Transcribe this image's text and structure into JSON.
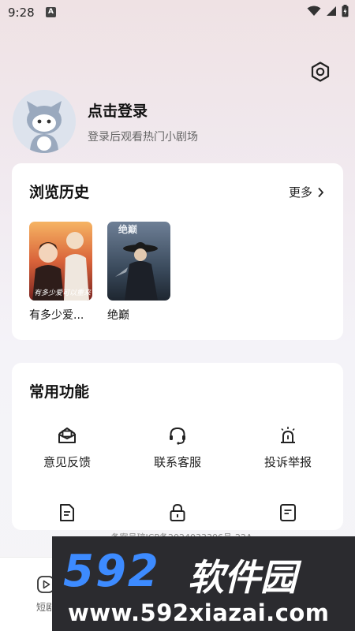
{
  "status_bar": {
    "time": "9:28",
    "notification_badge": "A"
  },
  "header": {
    "settings_icon": "gear-hexagon-icon"
  },
  "profile": {
    "title": "点击登录",
    "subtitle": "登录后观看热门小剧场"
  },
  "history": {
    "title": "浏览历史",
    "more_label": "更多",
    "items": [
      {
        "title": "有多少爱...",
        "poster_text": "有多少爱可以重来"
      },
      {
        "title": "绝巅",
        "poster_text": "绝巅"
      }
    ]
  },
  "functions": {
    "title": "常用功能",
    "items": [
      {
        "label": "意见反馈",
        "icon": "feedback-mail-icon"
      },
      {
        "label": "联系客服",
        "icon": "headset-icon"
      },
      {
        "label": "投诉举报",
        "icon": "alarm-icon"
      },
      {
        "label": "",
        "icon": "document-icon"
      },
      {
        "label": "",
        "icon": "lock-icon"
      },
      {
        "label": "",
        "icon": "note-icon"
      }
    ]
  },
  "footer": {
    "icp": "备案号琼ICP备2024033306号-22A"
  },
  "bottom_nav": {
    "items": [
      {
        "label": "短剧",
        "icon": "play-icon"
      }
    ]
  },
  "watermark": {
    "number": "592",
    "name": "软件园",
    "url": "www.592xiazai.com"
  },
  "colors": {
    "watermark_blue": "#3d8bff",
    "watermark_bg": "#2b2b2f",
    "card_bg": "#ffffff"
  }
}
